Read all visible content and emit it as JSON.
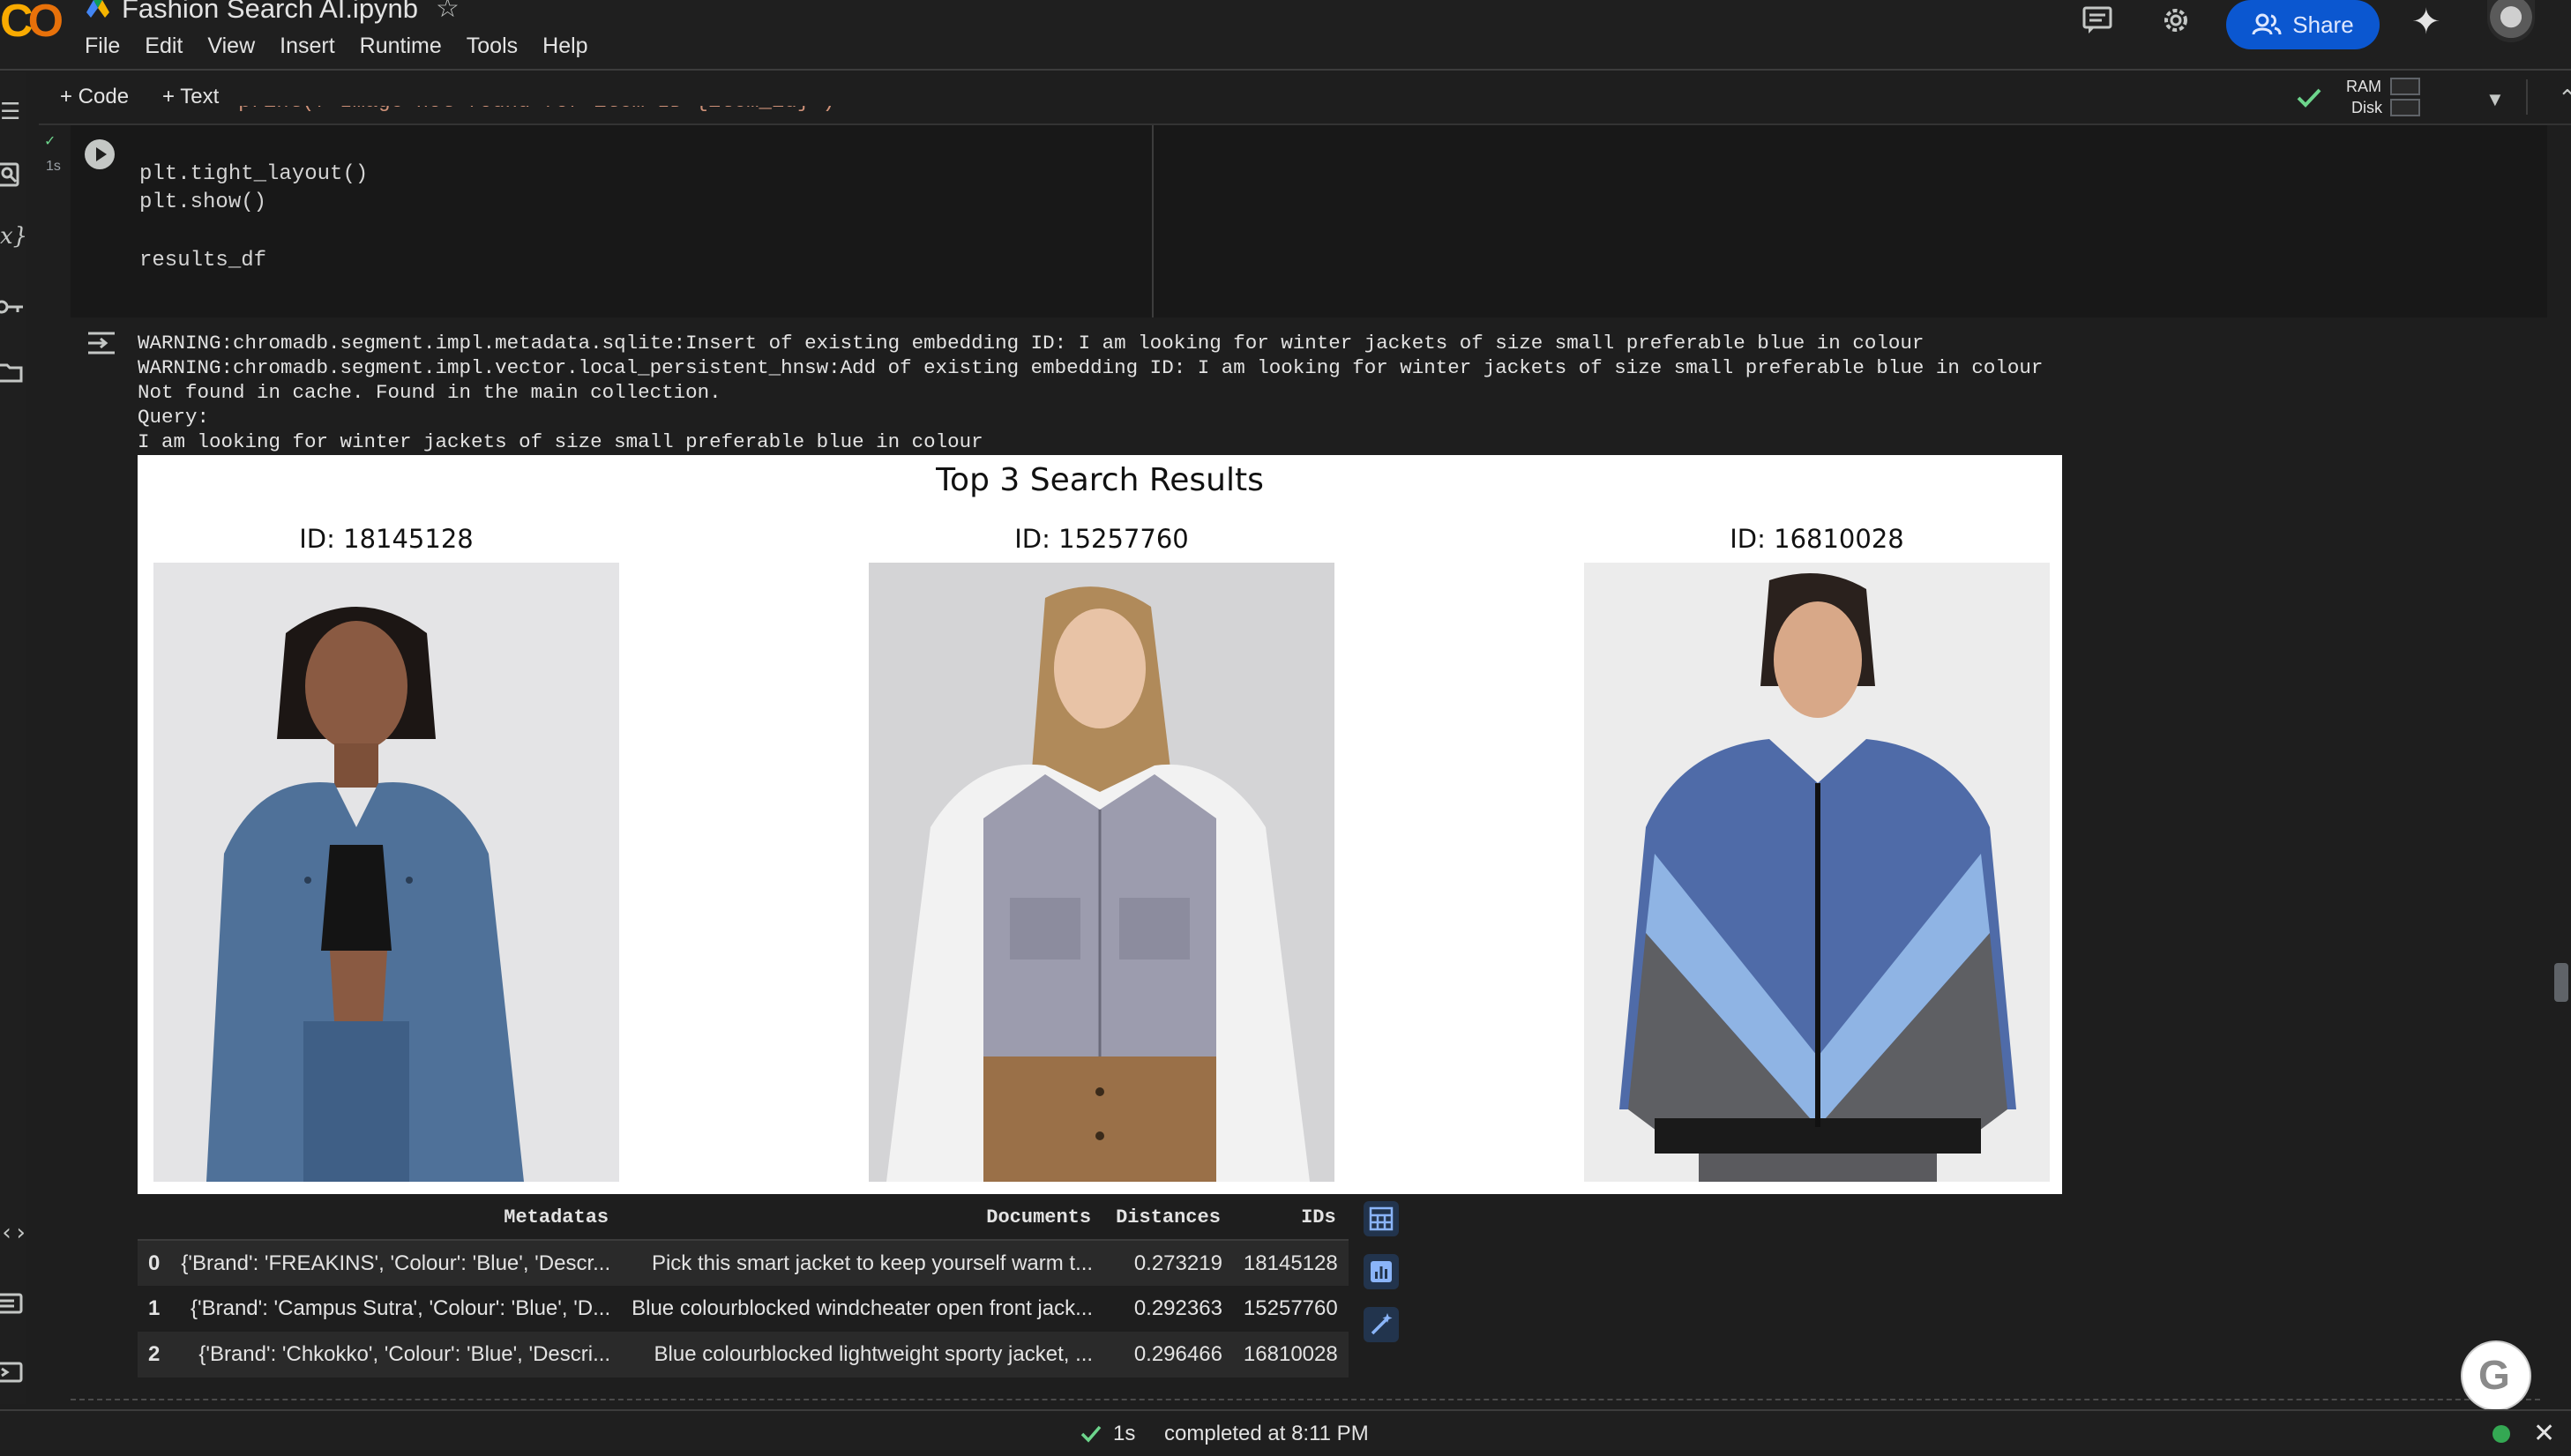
{
  "app": {
    "notebook_title": "Fashion Search AI.ipynb",
    "menu": [
      "File",
      "Edit",
      "View",
      "Insert",
      "Runtime",
      "Tools",
      "Help"
    ],
    "share_label": "Share"
  },
  "toolbar": {
    "add_code": "+ Code",
    "add_text": "+ Text",
    "ram_label": "RAM",
    "disk_label": "Disk"
  },
  "cell": {
    "status_check": "✓",
    "exec_time": "1s",
    "code_partial": "print(f\"Image not found for item ID {item_id}\")",
    "code_lines": [
      "plt.tight_layout()",
      "plt.show()",
      "results_df"
    ]
  },
  "output": {
    "log_lines": [
      "WARNING:chromadb.segment.impl.metadata.sqlite:Insert of existing embedding ID: I am looking for winter jackets of size small preferable blue in colour",
      "WARNING:chromadb.segment.impl.vector.local_persistent_hnsw:Add of existing embedding ID: I am looking for winter jackets of size small preferable blue in colour",
      "Not found in cache. Found in the main collection.",
      "Query:",
      "I am looking for winter jackets of size small preferable blue in colour"
    ],
    "figure": {
      "title": "Top 3 Search Results",
      "items": [
        {
          "label": "ID: 18145128",
          "desc": "denim jacket"
        },
        {
          "label": "ID: 15257760",
          "desc": "grey and white jacket"
        },
        {
          "label": "ID: 16810028",
          "desc": "blue colourblocked zip jacket"
        }
      ]
    },
    "table": {
      "columns": [
        "",
        "Metadatas",
        "Documents",
        "Distances",
        "IDs"
      ],
      "rows": [
        [
          "0",
          "{'Brand': 'FREAKINS', 'Colour': 'Blue', 'Descr...",
          "Pick this smart jacket to keep yourself warm t...",
          "0.273219",
          "18145128"
        ],
        [
          "1",
          "{'Brand': 'Campus Sutra', 'Colour': 'Blue', 'D...",
          "Blue colourblocked windcheater open front jack...",
          "0.292363",
          "15257760"
        ],
        [
          "2",
          "{'Brand': 'Chkokko', 'Colour': 'Blue', 'Descri...",
          "Blue colourblocked lightweight sporty jacket, ...",
          "0.296466",
          "16810028"
        ]
      ]
    }
  },
  "statusbar": {
    "time": "1s",
    "text": "completed at 8:11 PM"
  },
  "colors": {
    "accent": "#0b57d0",
    "success": "#34a853"
  }
}
